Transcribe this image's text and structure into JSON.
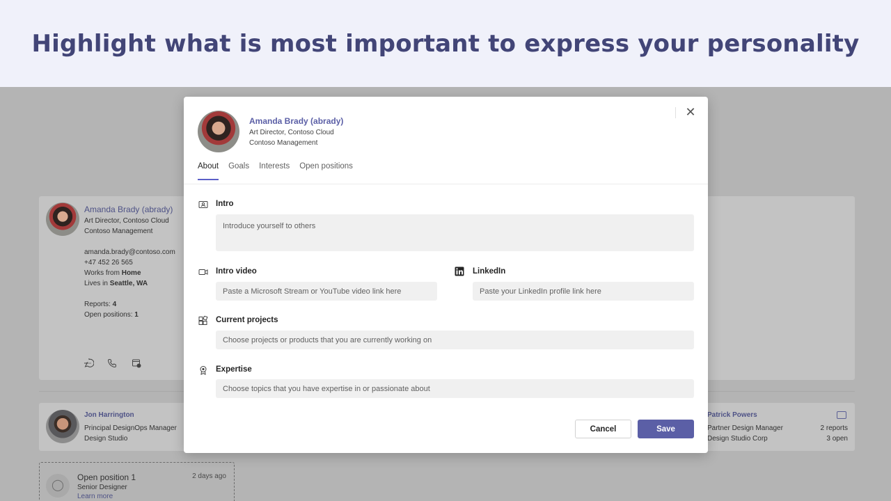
{
  "banner": {
    "headline": "Highlight what is most important to express your personality"
  },
  "profile_card": {
    "name": "Amanda Brady (abrady)",
    "title": "Art Director, Contoso Cloud",
    "department": "Contoso Management",
    "email": "amanda.brady@contoso.com",
    "phone": "+47 452 26 565",
    "works_from_prefix": "Works from ",
    "works_from_value": "Home",
    "lives_in_prefix": "Lives in ",
    "lives_in_value": "Seattle, WA",
    "reports_prefix": "Reports: ",
    "reports_value": "4",
    "open_positions_prefix": "Open positions: ",
    "open_positions_value": "1",
    "icons": [
      "chat-icon",
      "phone-icon",
      "calendar-icon"
    ]
  },
  "people": {
    "left": {
      "name": "Jon Harrington",
      "title": "Principal DesignOps Manager",
      "org": "Design Studio"
    },
    "right": {
      "name": "Patrick Powers",
      "title": "Partner Design Manager",
      "org": "Design Studio Corp",
      "reports": "2 reports",
      "open": "3 open"
    }
  },
  "open_position": {
    "title": "Open position 1",
    "age": "2 days ago",
    "role": "Senior Designer",
    "link": "Learn more"
  },
  "modal": {
    "name": "Amanda Brady (abrady)",
    "title": "Art Director, Contoso Cloud",
    "department": "Contoso Management",
    "tabs": [
      {
        "label": "About",
        "active": true
      },
      {
        "label": "Goals",
        "active": false
      },
      {
        "label": "Interests",
        "active": false
      },
      {
        "label": "Open positions",
        "active": false
      }
    ],
    "intro": {
      "label": "Intro",
      "placeholder": "Introduce yourself to others"
    },
    "intro_video": {
      "label": "Intro video",
      "placeholder": "Paste a Microsoft Stream or YouTube video link here"
    },
    "linkedin": {
      "label": "LinkedIn",
      "placeholder": "Paste your LinkedIn profile link here"
    },
    "projects": {
      "label": "Current projects",
      "placeholder": "Choose projects or products that you are currently working on"
    },
    "expertise": {
      "label": "Expertise",
      "placeholder": "Choose topics that you have expertise in or passionate about"
    },
    "cancel_label": "Cancel",
    "save_label": "Save"
  },
  "colors": {
    "accent": "#5b5fa6",
    "banner_text": "#424577",
    "banner_bg": "#f0f1fa"
  }
}
